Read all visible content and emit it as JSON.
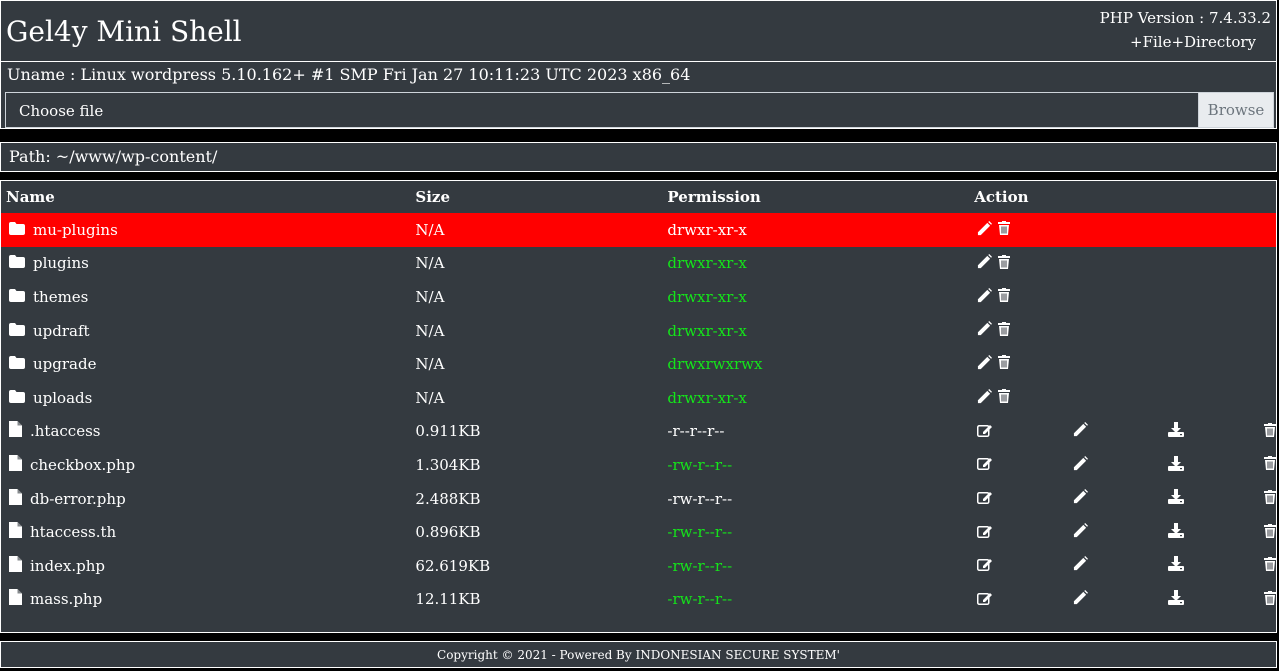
{
  "header": {
    "title": "Gel4y Mini Shell",
    "php_version": "PHP Version : 7.4.33.2",
    "new_item": "+File+Directory"
  },
  "system": {
    "uname": "Uname : Linux wordpress 5.10.162+ #1 SMP Fri Jan 27 10:11:23 UTC 2023 x86_64"
  },
  "upload": {
    "choose_label": "Choose file",
    "browse_label": "Browse"
  },
  "path": {
    "label": "Path: ~/www/wp-content/"
  },
  "table": {
    "headers": {
      "name": "Name",
      "size": "Size",
      "permission": "Permission",
      "action": "Action"
    },
    "rows": [
      {
        "type": "dir",
        "name": "mu-plugins",
        "size": "N/A",
        "perm": "drwxr-xr-x",
        "perm_color": "white",
        "selected": true
      },
      {
        "type": "dir",
        "name": "plugins",
        "size": "N/A",
        "perm": "drwxr-xr-x",
        "perm_color": "green"
      },
      {
        "type": "dir",
        "name": "themes",
        "size": "N/A",
        "perm": "drwxr-xr-x",
        "perm_color": "green"
      },
      {
        "type": "dir",
        "name": "updraft",
        "size": "N/A",
        "perm": "drwxr-xr-x",
        "perm_color": "green"
      },
      {
        "type": "dir",
        "name": "upgrade",
        "size": "N/A",
        "perm": "drwxrwxrwx",
        "perm_color": "green"
      },
      {
        "type": "dir",
        "name": "uploads",
        "size": "N/A",
        "perm": "drwxr-xr-x",
        "perm_color": "green"
      },
      {
        "type": "file",
        "name": ".htaccess",
        "size": "0.911KB",
        "perm": "-r--r--r--",
        "perm_color": "white"
      },
      {
        "type": "file",
        "name": "checkbox.php",
        "size": "1.304KB",
        "perm": "-rw-r--r--",
        "perm_color": "green"
      },
      {
        "type": "file",
        "name": "db-error.php",
        "size": "2.488KB",
        "perm": "-rw-r--r--",
        "perm_color": "white"
      },
      {
        "type": "file",
        "name": "htaccess.th",
        "size": "0.896KB",
        "perm": "-rw-r--r--",
        "perm_color": "green"
      },
      {
        "type": "file",
        "name": "index.php",
        "size": "62.619KB",
        "perm": "-rw-r--r--",
        "perm_color": "green"
      },
      {
        "type": "file",
        "name": "mass.php",
        "size": "12.11KB",
        "perm": "-rw-r--r--",
        "perm_color": "green"
      }
    ]
  },
  "footer": {
    "copyright": "Copyright © 2021 - Powered By INDONESIAN SECURE SYSTEM'"
  },
  "colors": {
    "background": "#343a40",
    "selected_row": "#ff0000",
    "perm_green": "#14e41a"
  },
  "icons": {
    "dir": "folder-icon",
    "file": "file-icon",
    "rename": "pencil-icon",
    "delete": "trash-icon",
    "edit": "edit-icon",
    "download": "download-icon"
  }
}
